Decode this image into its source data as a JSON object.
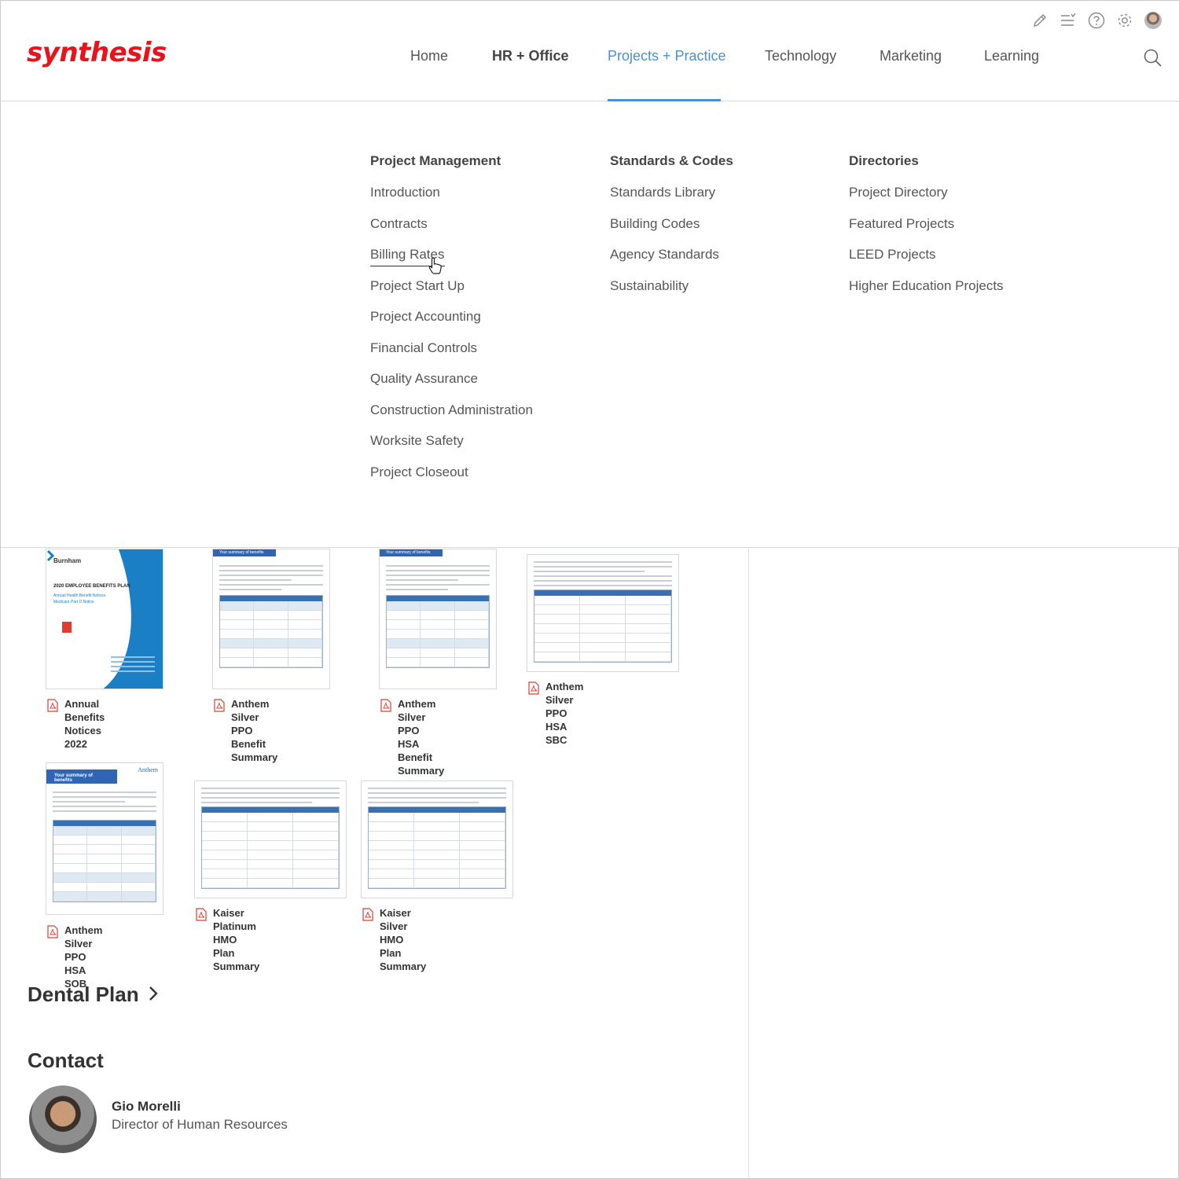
{
  "brand": {
    "logo_text": "synthesis",
    "accent": "#e8131b",
    "nav_active_color": "#4a90d9"
  },
  "utility_icons": [
    "pencil-icon",
    "list-icon",
    "help-icon",
    "gear-icon",
    "user-avatar"
  ],
  "nav": {
    "items": [
      {
        "label": "Home"
      },
      {
        "label": "HR + Office"
      },
      {
        "label": "Projects + Practice"
      },
      {
        "label": "Technology"
      },
      {
        "label": "Marketing"
      },
      {
        "label": "Learning"
      }
    ],
    "active": "Projects + Practice"
  },
  "menu": {
    "columns": [
      {
        "title": "Project Management",
        "items": [
          "Introduction",
          "Contracts",
          "Billing Rates",
          "Project Start Up",
          "Project Accounting",
          "Financial Controls",
          "Quality Assurance",
          "Construction Administration",
          "Worksite Safety",
          "Project Closeout"
        ]
      },
      {
        "title": "Standards & Codes",
        "items": [
          "Standards Library",
          "Building Codes",
          "Agency Standards",
          "Sustainability"
        ]
      },
      {
        "title": "Directories",
        "items": [
          "Project Directory",
          "Featured Projects",
          "LEED Projects",
          "Higher Education Projects"
        ]
      }
    ],
    "hovered_item": "Billing Rates"
  },
  "documents": [
    {
      "line1": "Annual Benefits",
      "line2": "Notices 2022",
      "line3": ""
    },
    {
      "line1": "Anthem Silver PPO",
      "line2": "Benefit Summary",
      "line3": ""
    },
    {
      "line1": "Anthem Silver PPO",
      "line2": "HSA Benefit",
      "line3": "Summary"
    },
    {
      "line1": "Anthem Silver PPO HSA",
      "line2": "SBC",
      "line3": ""
    },
    {
      "line1": "Anthem Silver PPO",
      "line2": "HSA SOB",
      "line3": ""
    },
    {
      "line1": "Kaiser Platinum HMO Plan",
      "line2": "Summary",
      "line3": ""
    },
    {
      "line1": "Kaiser Silver HMO Plan",
      "line2": "Summary",
      "line3": ""
    }
  ],
  "thumb_text": {
    "burnham_brand": "Burnham",
    "burnham_title": "2020 EMPLOYEE BENEFITS PLAN",
    "burnham_sub1": "Annual Health Benefit Notices",
    "burnham_sub2": "Medicare Part D Notice",
    "summary_banner": "Your summary of benefits",
    "anthem_brand": "Anthem"
  },
  "sections": {
    "dental": "Dental Plan",
    "contact": "Contact"
  },
  "contact": {
    "name": "Gio Morelli",
    "role": "Director of Human Resources"
  }
}
